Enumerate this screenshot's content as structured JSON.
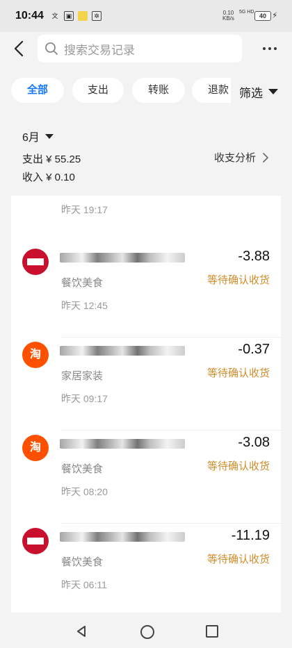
{
  "status_bar": {
    "time": "10:44",
    "network_speed_top": "0.10",
    "network_speed_bottom": "KB/s",
    "signal_text": "5G HD",
    "battery": "40"
  },
  "header": {
    "search_placeholder": "搜索交易记录"
  },
  "tabs": [
    {
      "label": "全部",
      "active": true
    },
    {
      "label": "支出",
      "active": false
    },
    {
      "label": "转账",
      "active": false
    },
    {
      "label": "退款",
      "active": false
    }
  ],
  "filter_label": "筛选",
  "summary": {
    "month": "6月",
    "expense": "支出 ¥ 55.25",
    "income": "收入 ¥ 0.10",
    "analysis": "收支分析"
  },
  "list": {
    "top_time": "昨天 19:17",
    "items": [
      {
        "icon": "restaurant-logo-icon",
        "category": "餐饮美食",
        "time": "昨天 12:45",
        "amount": "-3.88",
        "status": "等待确认收货"
      },
      {
        "icon": "taobao-icon",
        "icon_text": "淘",
        "category": "家居家装",
        "time": "昨天 09:17",
        "amount": "-0.37",
        "status": "等待确认收货"
      },
      {
        "icon": "taobao-icon",
        "icon_text": "淘",
        "category": "餐饮美食",
        "time": "昨天 08:20",
        "amount": "-3.08",
        "status": "等待确认收货"
      },
      {
        "icon": "restaurant-logo-icon",
        "category": "餐饮美食",
        "time": "昨天 06:11",
        "amount": "-11.19",
        "status": "等待确认收货"
      }
    ]
  },
  "colors": {
    "accent": "#1677ff",
    "status": "#d08c2a",
    "taobao": "#ff5000",
    "restaurant": "#c8102e"
  }
}
